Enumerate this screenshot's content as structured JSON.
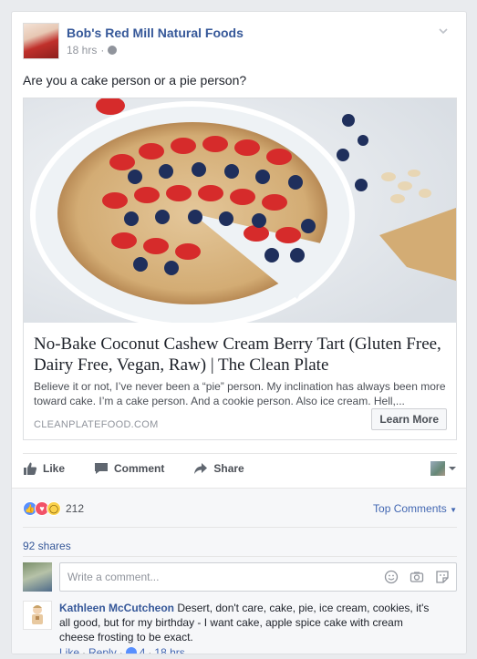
{
  "post": {
    "page_name": "Bob's Red Mill Natural Foods",
    "time": "18 hrs",
    "separator": "·",
    "message": "Are you a cake person or a pie person?"
  },
  "link_preview": {
    "title": "No-Bake Coconut Cashew Cream Berry Tart (Gluten Free, Dairy Free, Vegan, Raw) | The Clean Plate",
    "description": "Believe it or not, I’ve never been a “pie” person. My inclination has always been more toward cake. I’m a cake person. And a cookie person. Also ice cream. Hell,...",
    "domain": "CLEANPLATEFOOD.COM",
    "cta_label": "Learn More"
  },
  "actions": {
    "like": "Like",
    "comment": "Comment",
    "share": "Share"
  },
  "reactions": {
    "count": "212",
    "sort_label": "Top Comments"
  },
  "shares": "92 shares",
  "composer": {
    "placeholder": "Write a comment..."
  },
  "comments": [
    {
      "author": "Kathleen McCutcheon",
      "text": "Desert, don't care, cake, pie, ice cream, cookies, it's all good, but for my birthday - I want cake, apple spice cake with cream cheese frosting to be exact.",
      "like_label": "Like",
      "reply_label": "Reply",
      "like_count": "4",
      "time": "18 hrs",
      "dot": "·"
    }
  ],
  "colors": {
    "link_blue": "#365899",
    "like_blue": "#5890ff",
    "love_red": "#f25268",
    "wow_yellow": "#fbd14b"
  }
}
